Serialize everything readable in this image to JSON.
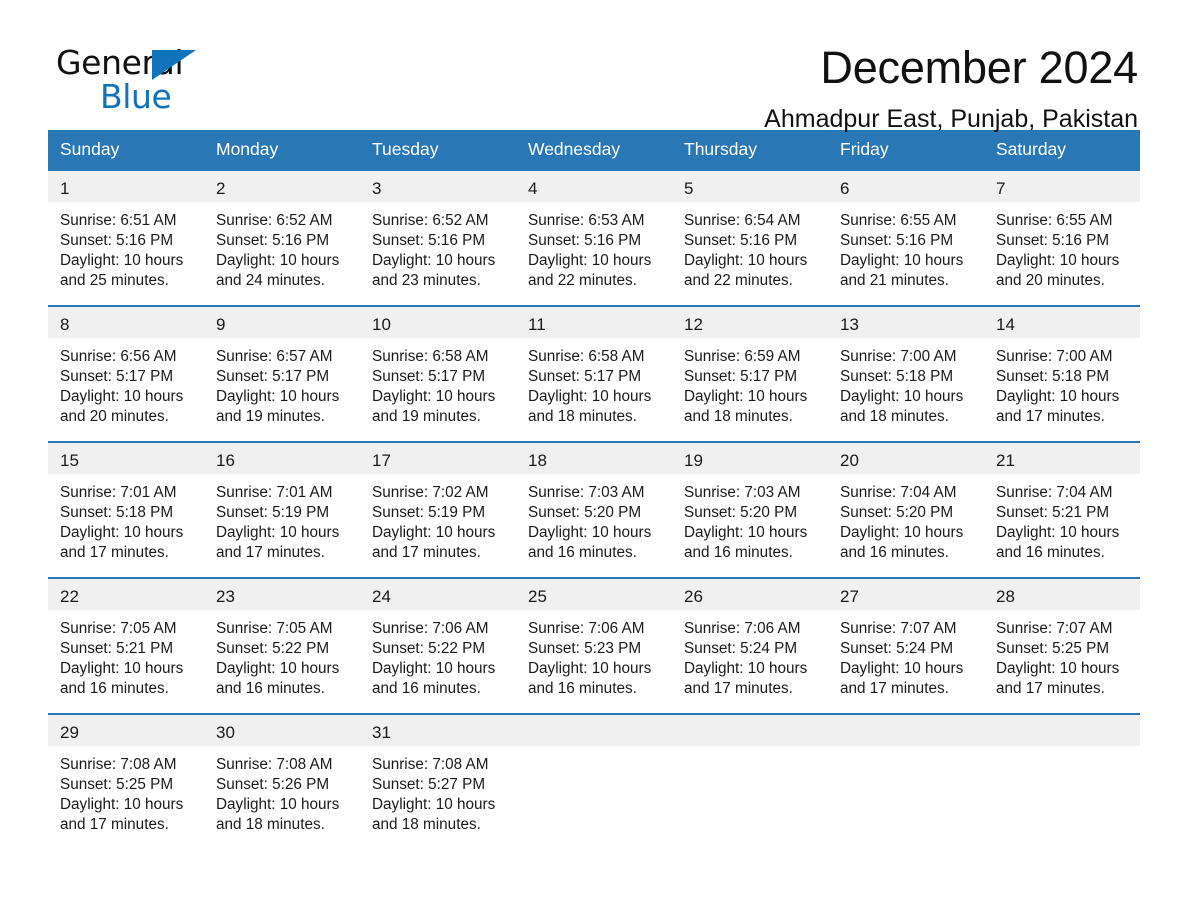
{
  "logo": {
    "word_one": "General",
    "word_two": "Blue",
    "triangle_icon": "blue-triangle-icon",
    "brand_color": "#1273bd"
  },
  "header": {
    "title": "December 2024",
    "location": "Ahmadpur East, Punjab, Pakistan"
  },
  "theme": {
    "header_blue": "#2a77b5",
    "row_gray": "#f0f0f0",
    "text": "#1a1a1a"
  },
  "calendar": {
    "weekdays": [
      "Sunday",
      "Monday",
      "Tuesday",
      "Wednesday",
      "Thursday",
      "Friday",
      "Saturday"
    ],
    "weeks": [
      [
        {
          "day": "1",
          "sunrise": "Sunrise: 6:51 AM",
          "sunset": "Sunset: 5:16 PM",
          "daylight_1": "Daylight: 10 hours",
          "daylight_2": "and 25 minutes."
        },
        {
          "day": "2",
          "sunrise": "Sunrise: 6:52 AM",
          "sunset": "Sunset: 5:16 PM",
          "daylight_1": "Daylight: 10 hours",
          "daylight_2": "and 24 minutes."
        },
        {
          "day": "3",
          "sunrise": "Sunrise: 6:52 AM",
          "sunset": "Sunset: 5:16 PM",
          "daylight_1": "Daylight: 10 hours",
          "daylight_2": "and 23 minutes."
        },
        {
          "day": "4",
          "sunrise": "Sunrise: 6:53 AM",
          "sunset": "Sunset: 5:16 PM",
          "daylight_1": "Daylight: 10 hours",
          "daylight_2": "and 22 minutes."
        },
        {
          "day": "5",
          "sunrise": "Sunrise: 6:54 AM",
          "sunset": "Sunset: 5:16 PM",
          "daylight_1": "Daylight: 10 hours",
          "daylight_2": "and 22 minutes."
        },
        {
          "day": "6",
          "sunrise": "Sunrise: 6:55 AM",
          "sunset": "Sunset: 5:16 PM",
          "daylight_1": "Daylight: 10 hours",
          "daylight_2": "and 21 minutes."
        },
        {
          "day": "7",
          "sunrise": "Sunrise: 6:55 AM",
          "sunset": "Sunset: 5:16 PM",
          "daylight_1": "Daylight: 10 hours",
          "daylight_2": "and 20 minutes."
        }
      ],
      [
        {
          "day": "8",
          "sunrise": "Sunrise: 6:56 AM",
          "sunset": "Sunset: 5:17 PM",
          "daylight_1": "Daylight: 10 hours",
          "daylight_2": "and 20 minutes."
        },
        {
          "day": "9",
          "sunrise": "Sunrise: 6:57 AM",
          "sunset": "Sunset: 5:17 PM",
          "daylight_1": "Daylight: 10 hours",
          "daylight_2": "and 19 minutes."
        },
        {
          "day": "10",
          "sunrise": "Sunrise: 6:58 AM",
          "sunset": "Sunset: 5:17 PM",
          "daylight_1": "Daylight: 10 hours",
          "daylight_2": "and 19 minutes."
        },
        {
          "day": "11",
          "sunrise": "Sunrise: 6:58 AM",
          "sunset": "Sunset: 5:17 PM",
          "daylight_1": "Daylight: 10 hours",
          "daylight_2": "and 18 minutes."
        },
        {
          "day": "12",
          "sunrise": "Sunrise: 6:59 AM",
          "sunset": "Sunset: 5:17 PM",
          "daylight_1": "Daylight: 10 hours",
          "daylight_2": "and 18 minutes."
        },
        {
          "day": "13",
          "sunrise": "Sunrise: 7:00 AM",
          "sunset": "Sunset: 5:18 PM",
          "daylight_1": "Daylight: 10 hours",
          "daylight_2": "and 18 minutes."
        },
        {
          "day": "14",
          "sunrise": "Sunrise: 7:00 AM",
          "sunset": "Sunset: 5:18 PM",
          "daylight_1": "Daylight: 10 hours",
          "daylight_2": "and 17 minutes."
        }
      ],
      [
        {
          "day": "15",
          "sunrise": "Sunrise: 7:01 AM",
          "sunset": "Sunset: 5:18 PM",
          "daylight_1": "Daylight: 10 hours",
          "daylight_2": "and 17 minutes."
        },
        {
          "day": "16",
          "sunrise": "Sunrise: 7:01 AM",
          "sunset": "Sunset: 5:19 PM",
          "daylight_1": "Daylight: 10 hours",
          "daylight_2": "and 17 minutes."
        },
        {
          "day": "17",
          "sunrise": "Sunrise: 7:02 AM",
          "sunset": "Sunset: 5:19 PM",
          "daylight_1": "Daylight: 10 hours",
          "daylight_2": "and 17 minutes."
        },
        {
          "day": "18",
          "sunrise": "Sunrise: 7:03 AM",
          "sunset": "Sunset: 5:20 PM",
          "daylight_1": "Daylight: 10 hours",
          "daylight_2": "and 16 minutes."
        },
        {
          "day": "19",
          "sunrise": "Sunrise: 7:03 AM",
          "sunset": "Sunset: 5:20 PM",
          "daylight_1": "Daylight: 10 hours",
          "daylight_2": "and 16 minutes."
        },
        {
          "day": "20",
          "sunrise": "Sunrise: 7:04 AM",
          "sunset": "Sunset: 5:20 PM",
          "daylight_1": "Daylight: 10 hours",
          "daylight_2": "and 16 minutes."
        },
        {
          "day": "21",
          "sunrise": "Sunrise: 7:04 AM",
          "sunset": "Sunset: 5:21 PM",
          "daylight_1": "Daylight: 10 hours",
          "daylight_2": "and 16 minutes."
        }
      ],
      [
        {
          "day": "22",
          "sunrise": "Sunrise: 7:05 AM",
          "sunset": "Sunset: 5:21 PM",
          "daylight_1": "Daylight: 10 hours",
          "daylight_2": "and 16 minutes."
        },
        {
          "day": "23",
          "sunrise": "Sunrise: 7:05 AM",
          "sunset": "Sunset: 5:22 PM",
          "daylight_1": "Daylight: 10 hours",
          "daylight_2": "and 16 minutes."
        },
        {
          "day": "24",
          "sunrise": "Sunrise: 7:06 AM",
          "sunset": "Sunset: 5:22 PM",
          "daylight_1": "Daylight: 10 hours",
          "daylight_2": "and 16 minutes."
        },
        {
          "day": "25",
          "sunrise": "Sunrise: 7:06 AM",
          "sunset": "Sunset: 5:23 PM",
          "daylight_1": "Daylight: 10 hours",
          "daylight_2": "and 16 minutes."
        },
        {
          "day": "26",
          "sunrise": "Sunrise: 7:06 AM",
          "sunset": "Sunset: 5:24 PM",
          "daylight_1": "Daylight: 10 hours",
          "daylight_2": "and 17 minutes."
        },
        {
          "day": "27",
          "sunrise": "Sunrise: 7:07 AM",
          "sunset": "Sunset: 5:24 PM",
          "daylight_1": "Daylight: 10 hours",
          "daylight_2": "and 17 minutes."
        },
        {
          "day": "28",
          "sunrise": "Sunrise: 7:07 AM",
          "sunset": "Sunset: 5:25 PM",
          "daylight_1": "Daylight: 10 hours",
          "daylight_2": "and 17 minutes."
        }
      ],
      [
        {
          "day": "29",
          "sunrise": "Sunrise: 7:08 AM",
          "sunset": "Sunset: 5:25 PM",
          "daylight_1": "Daylight: 10 hours",
          "daylight_2": "and 17 minutes."
        },
        {
          "day": "30",
          "sunrise": "Sunrise: 7:08 AM",
          "sunset": "Sunset: 5:26 PM",
          "daylight_1": "Daylight: 10 hours",
          "daylight_2": "and 18 minutes."
        },
        {
          "day": "31",
          "sunrise": "Sunrise: 7:08 AM",
          "sunset": "Sunset: 5:27 PM",
          "daylight_1": "Daylight: 10 hours",
          "daylight_2": "and 18 minutes."
        },
        {
          "day": "",
          "sunrise": "",
          "sunset": "",
          "daylight_1": "",
          "daylight_2": ""
        },
        {
          "day": "",
          "sunrise": "",
          "sunset": "",
          "daylight_1": "",
          "daylight_2": ""
        },
        {
          "day": "",
          "sunrise": "",
          "sunset": "",
          "daylight_1": "",
          "daylight_2": ""
        },
        {
          "day": "",
          "sunrise": "",
          "sunset": "",
          "daylight_1": "",
          "daylight_2": ""
        }
      ]
    ]
  }
}
